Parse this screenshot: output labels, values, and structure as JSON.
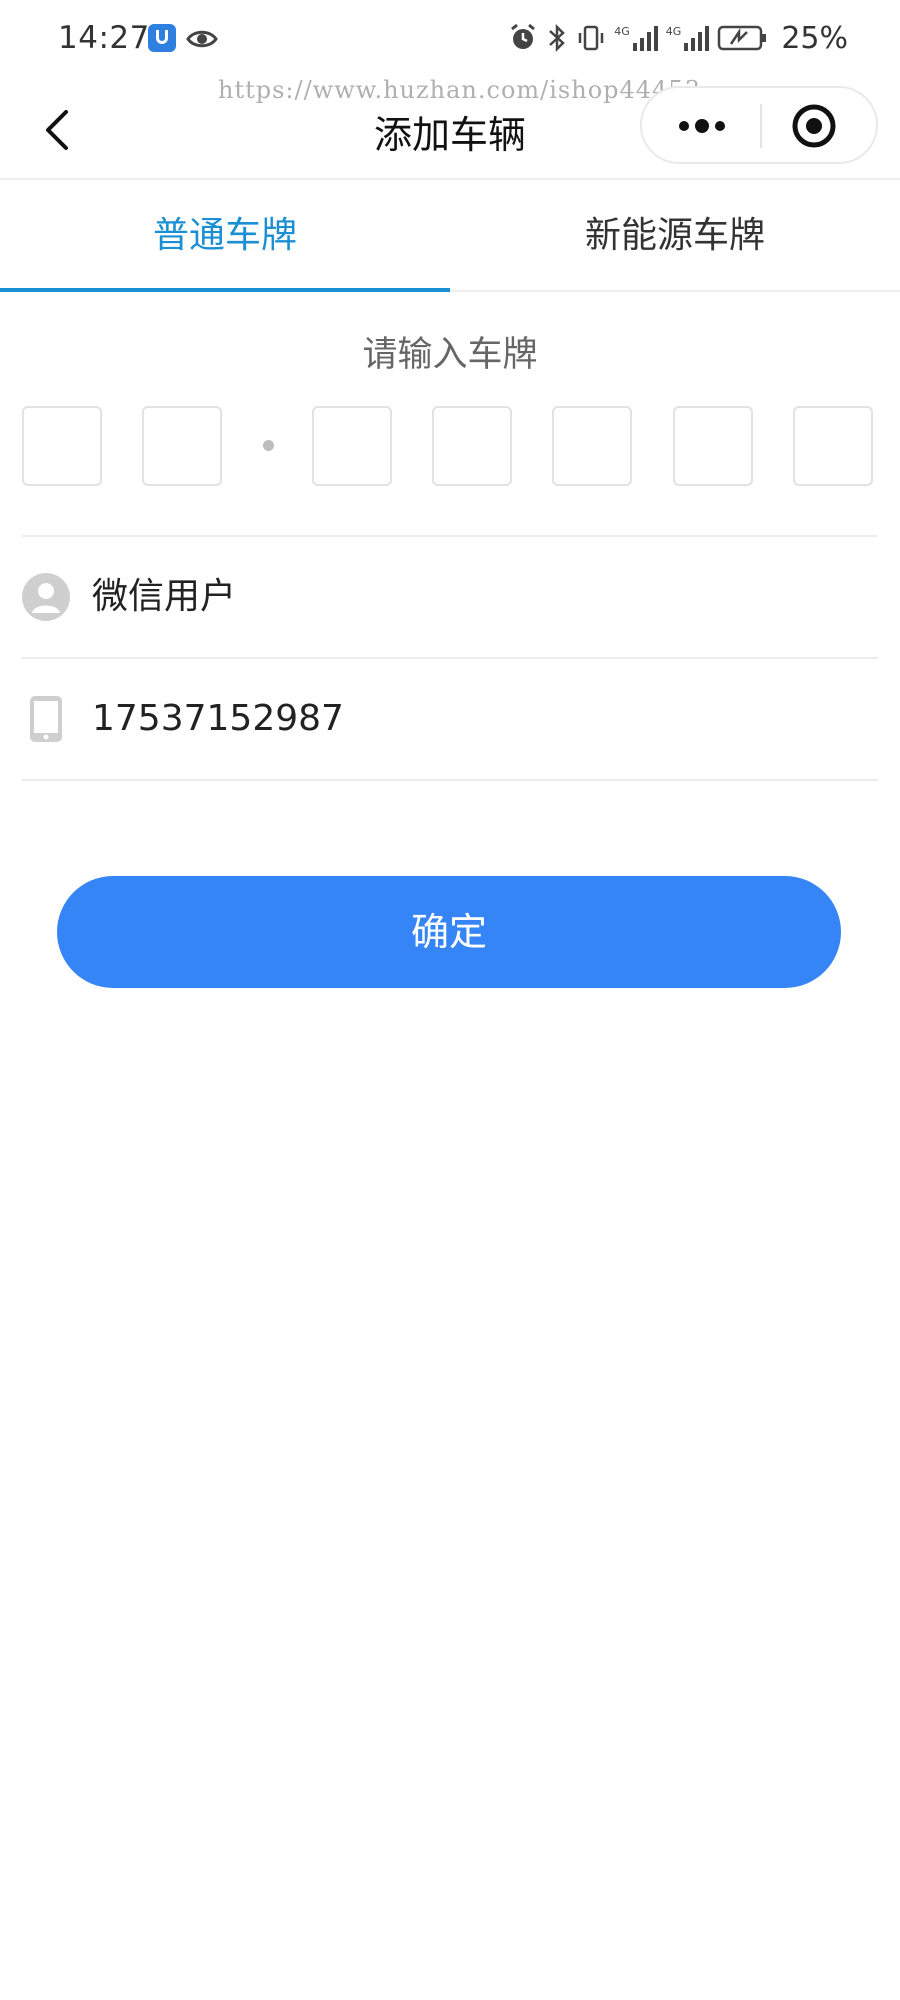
{
  "status_bar": {
    "time": "14:27",
    "battery": "25%",
    "network_1": "4G",
    "network_2": "4G"
  },
  "watermark": "https://www.huzhan.com/ishop44453",
  "nav": {
    "title": "添加车辆"
  },
  "tabs": [
    {
      "label": "普通车牌",
      "active": true
    },
    {
      "label": "新能源车牌",
      "active": false
    }
  ],
  "plate": {
    "prompt": "请输入车牌",
    "slot_count": 7
  },
  "user": {
    "name": "微信用户",
    "phone": "17537152987"
  },
  "confirm_label": "确定",
  "colors": {
    "accent": "#1a8fd3",
    "button": "#3585f6",
    "icon_gray": "#cfcfcf"
  }
}
